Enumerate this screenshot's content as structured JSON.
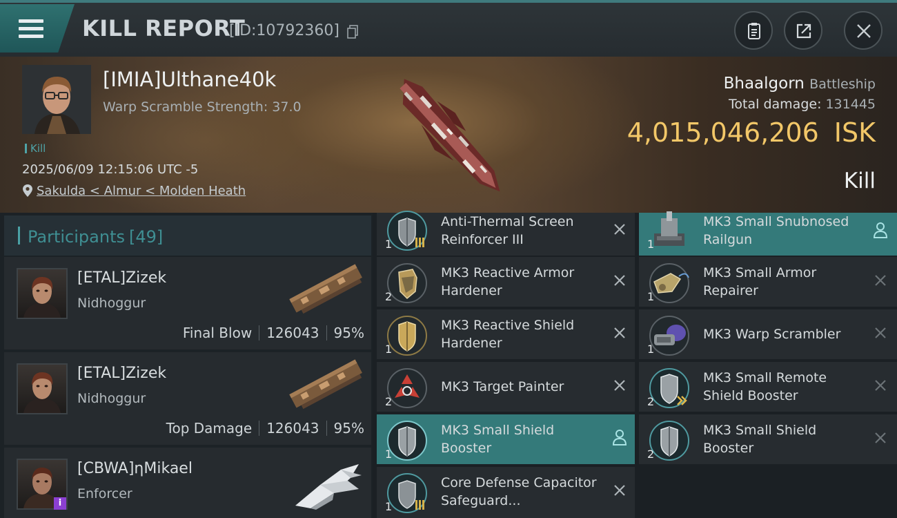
{
  "header": {
    "title": "KILL REPORT",
    "kill_id": "[ID:10792360]"
  },
  "victim": {
    "name": "[IMIA]Ulthane40k",
    "warp_scramble": "Warp Scramble Strength: 37.0",
    "kill_tag": "Kill",
    "datetime": "2025/06/09 12:15:06 UTC -5",
    "location": "Sakulda < Almur < Molden Heath",
    "ship_name": "Bhaalgorn",
    "ship_class": "Battleship",
    "total_damage_label": "Total damage:",
    "total_damage": "131445",
    "isk_value": "4,015,046,206",
    "isk_unit": "ISK",
    "result": "Kill"
  },
  "participants": {
    "label": "Participants",
    "count": "[49]",
    "rows": [
      {
        "name": "[ETAL]Zizek",
        "ship": "Nidhoggur",
        "role": "Final Blow",
        "damage": "126043",
        "percent": "95%"
      },
      {
        "name": "[ETAL]Zizek",
        "ship": "Nidhoggur",
        "role": "Top Damage",
        "damage": "126043",
        "percent": "95%"
      },
      {
        "name": "[CBWA]ηMikael",
        "ship": "Enforcer"
      }
    ]
  },
  "modules": {
    "col1": [
      {
        "name": "Anti-Thermal Screen Reinforcer III",
        "qty": "1",
        "icon": "thermal-shield-icon"
      },
      {
        "name": "MK3 Reactive Armor Hardener",
        "qty": "2",
        "icon": "armor-hardener-icon"
      },
      {
        "name": "MK3 Reactive Shield Hardener",
        "qty": "1",
        "icon": "shield-hardener-icon"
      },
      {
        "name": "MK3 Target Painter",
        "qty": "2",
        "icon": "target-painter-icon"
      },
      {
        "name": "MK3 Small Shield Booster",
        "qty": "1",
        "icon": "shield-booster-icon"
      },
      {
        "name": "Core Defense Capacitor Safeguard...",
        "qty": "1",
        "icon": "capacitor-rig-icon"
      }
    ],
    "col2": [
      {
        "name": "MK3 Small Snubnosed Railgun",
        "qty": "1",
        "icon": "railgun-icon"
      },
      {
        "name": "MK3 Small Armor Repairer",
        "qty": "1",
        "icon": "armor-repairer-icon"
      },
      {
        "name": "MK3 Warp Scrambler",
        "qty": "1",
        "icon": "warp-scrambler-icon"
      },
      {
        "name": "MK3 Small Remote Shield Booster",
        "qty": "2",
        "icon": "remote-shield-icon"
      },
      {
        "name": "MK3 Small Shield Booster",
        "qty": "2",
        "icon": "shield-booster-icon"
      }
    ]
  },
  "colors": {
    "accent": "#3f8f93",
    "isk": "#f2c768",
    "active_row": "#347a7a"
  }
}
